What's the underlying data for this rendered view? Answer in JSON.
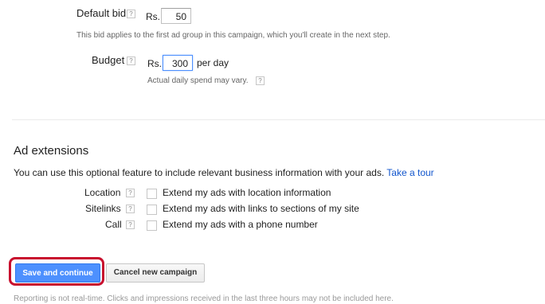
{
  "bidding": {
    "default_bid_label": "Default bid",
    "default_bid_currency": "Rs.",
    "default_bid_value": "50",
    "default_bid_hint": "This bid applies to the first ad group in this campaign, which you'll create in the next step.",
    "budget_label": "Budget",
    "budget_currency": "Rs.",
    "budget_value": "300",
    "budget_unit": "per day",
    "budget_hint": "Actual daily spend may vary.",
    "help_glyph": "?"
  },
  "ad_extensions": {
    "heading": "Ad extensions",
    "description": "You can use this optional feature to include relevant business information with your ads.",
    "tour_link": "Take a tour",
    "items": [
      {
        "label": "Location",
        "checkbox_text": "Extend my ads with location information",
        "checked": false
      },
      {
        "label": "Sitelinks",
        "checkbox_text": "Extend my ads with links to sections of my site",
        "checked": false
      },
      {
        "label": "Call",
        "checkbox_text": "Extend my ads with a phone number",
        "checked": false
      }
    ]
  },
  "actions": {
    "save_label": "Save and continue",
    "cancel_label": "Cancel new campaign"
  },
  "footer": {
    "note": "Reporting is not real-time. Clicks and impressions received in the last three hours may not be included here."
  },
  "colors": {
    "primary_button": "#4d90fe",
    "highlight_outline": "#c8102e",
    "link": "#1155cc",
    "focus_border": "#4d90fe"
  }
}
